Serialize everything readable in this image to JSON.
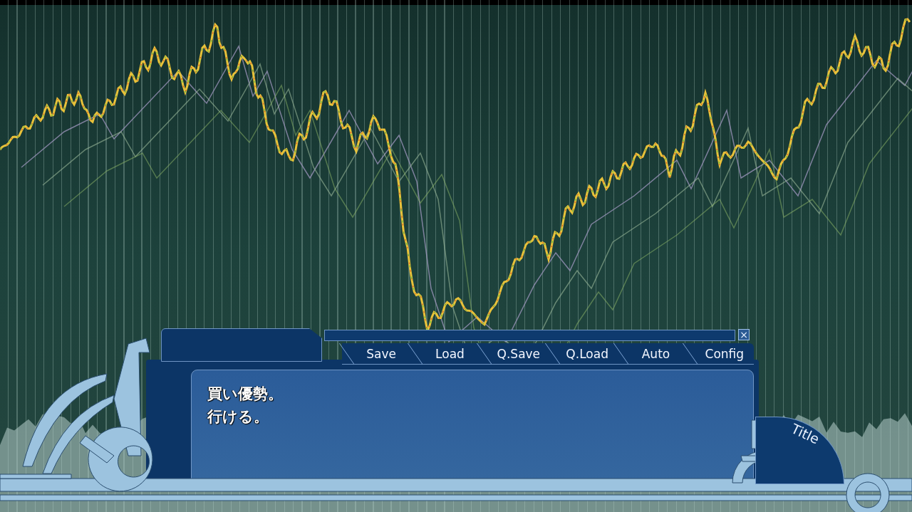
{
  "message": {
    "lines": [
      "買い優勢。",
      "行ける。"
    ]
  },
  "menu": [
    {
      "label": "Save"
    },
    {
      "label": "Load"
    },
    {
      "label": "Q.Save"
    },
    {
      "label": "Q.Load"
    },
    {
      "label": "Auto"
    },
    {
      "label": "Config"
    }
  ],
  "close_button": {
    "label": "×"
  },
  "title_button": {
    "label": "Title"
  }
}
